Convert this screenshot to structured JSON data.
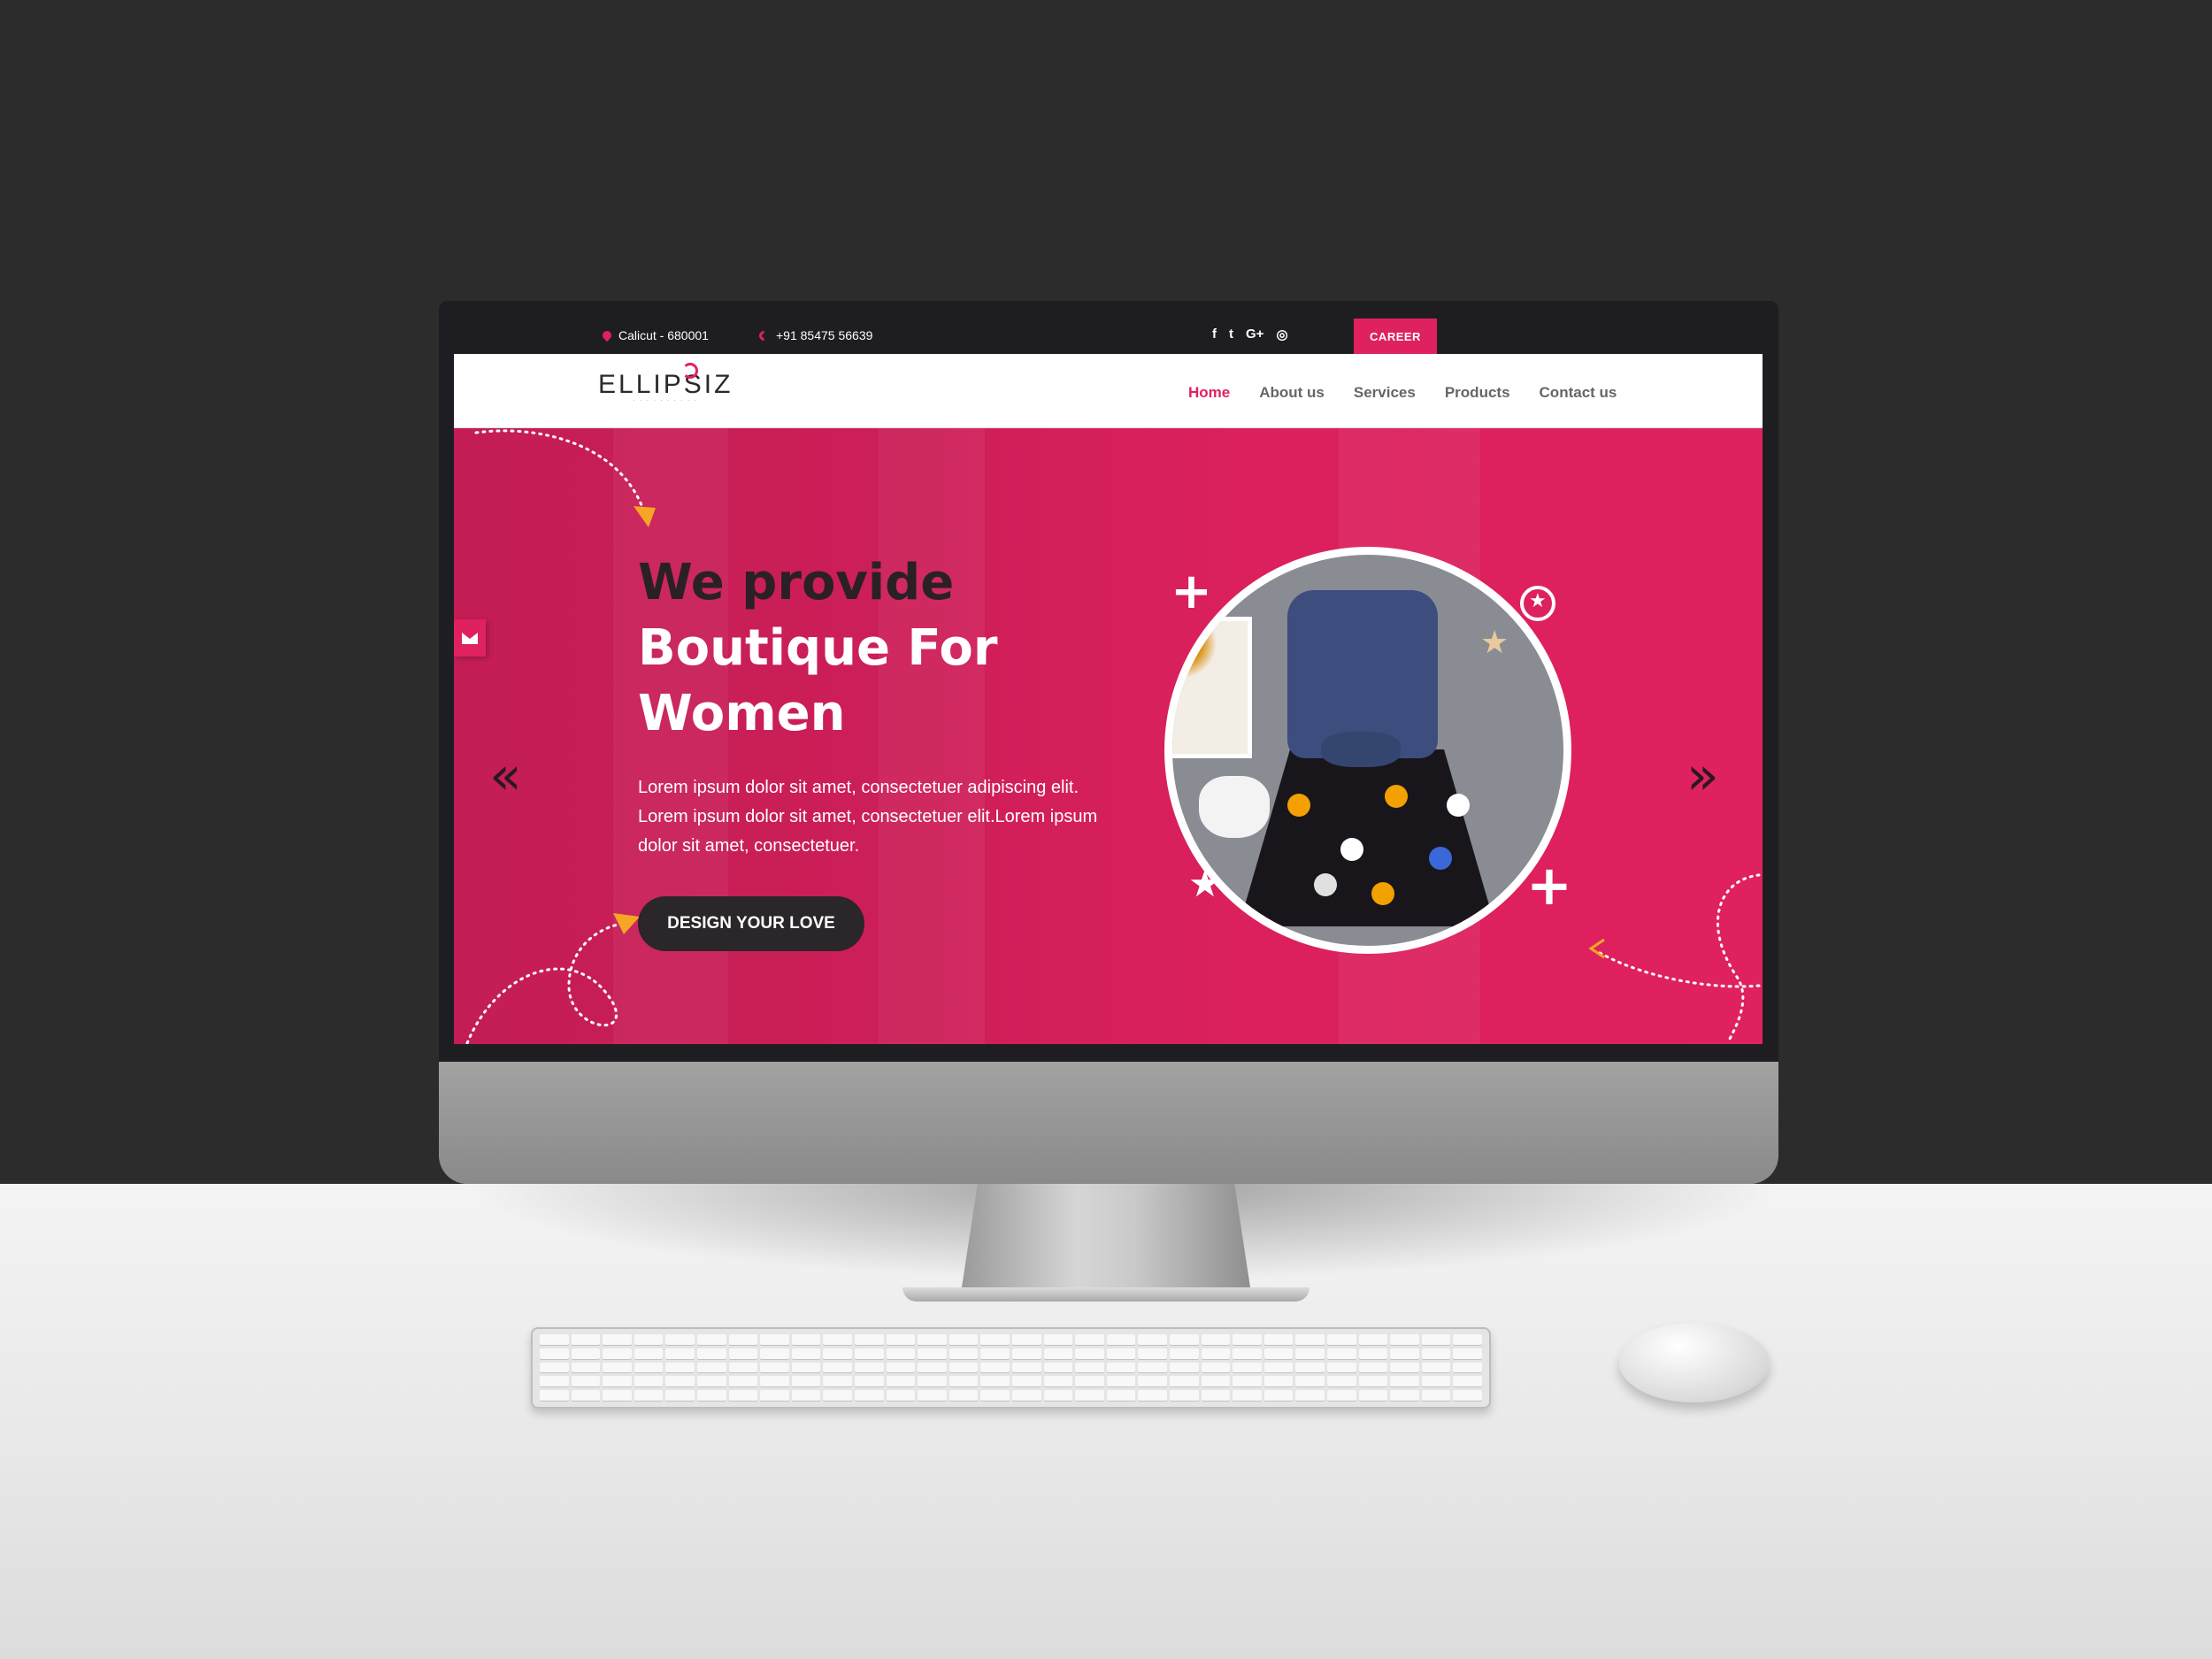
{
  "topbar": {
    "location": "Calicut - 680001",
    "phone": "+91 85475 56639",
    "social": [
      "f",
      "t",
      "G+",
      "◎"
    ],
    "career_label": "CAREER"
  },
  "brand": {
    "name": "ELLIPSIZ",
    "tagline": "ELLIPSIZ"
  },
  "nav": {
    "items": [
      {
        "label": "Home",
        "active": true
      },
      {
        "label": "About us"
      },
      {
        "label": "Services"
      },
      {
        "label": "Products"
      },
      {
        "label": "Contact us"
      }
    ]
  },
  "hero": {
    "line1": "We provide",
    "line2": "Boutique For",
    "line3": "Women",
    "description": "Lorem ipsum dolor sit amet, consectetuer adipiscing elit. Lorem ipsum dolor sit amet, consectetuer elit.Lorem ipsum dolor sit amet, consectetuer.",
    "cta_label": "DESIGN YOUR LOVE",
    "prev_icon": "«",
    "next_icon": "»"
  },
  "colors": {
    "accent": "#e0215f",
    "dark": "#2a2629",
    "topbar": "#1e1e21"
  },
  "icons": [
    "map-pin-icon",
    "phone-icon",
    "facebook-icon",
    "twitter-icon",
    "google-plus-icon",
    "instagram-icon",
    "mail-icon",
    "chevron-left-double-icon",
    "chevron-right-double-icon"
  ]
}
